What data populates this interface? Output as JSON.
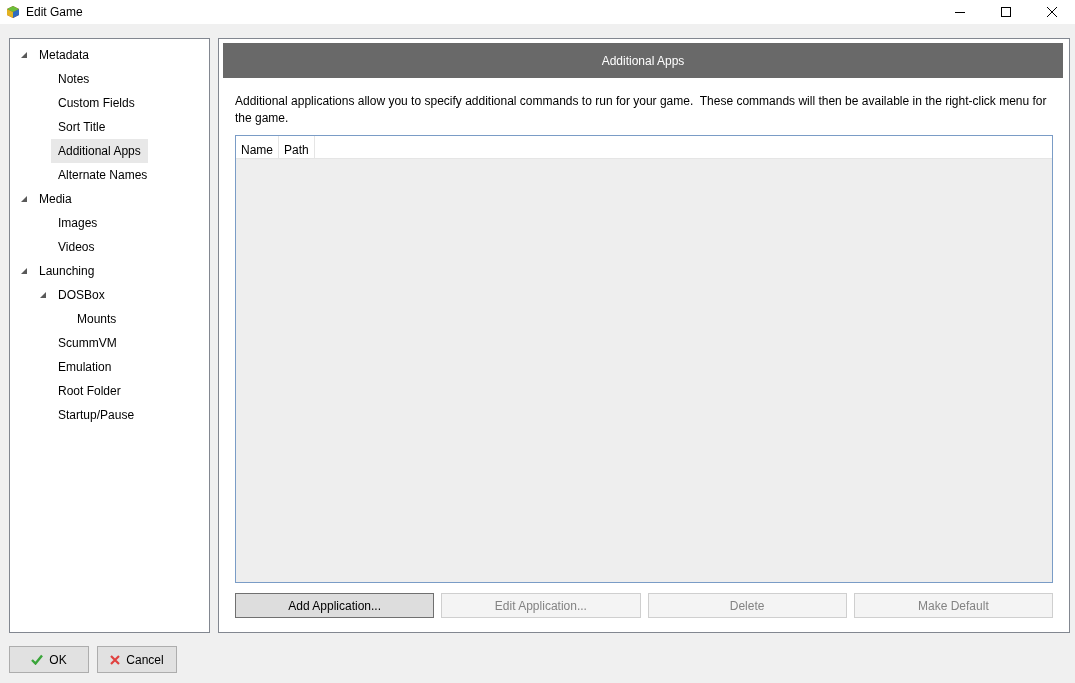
{
  "window": {
    "title": "Edit Game"
  },
  "tree": [
    {
      "label": "Metadata",
      "expanded": true,
      "selected": false,
      "children": [
        {
          "label": "Notes",
          "selected": false
        },
        {
          "label": "Custom Fields",
          "selected": false
        },
        {
          "label": "Sort Title",
          "selected": false
        },
        {
          "label": "Additional Apps",
          "selected": true
        },
        {
          "label": "Alternate Names",
          "selected": false
        }
      ]
    },
    {
      "label": "Media",
      "expanded": true,
      "selected": false,
      "children": [
        {
          "label": "Images",
          "selected": false
        },
        {
          "label": "Videos",
          "selected": false
        }
      ]
    },
    {
      "label": "Launching",
      "expanded": true,
      "selected": false,
      "children": [
        {
          "label": "DOSBox",
          "expanded": true,
          "selected": false,
          "children": [
            {
              "label": "Mounts",
              "selected": false
            }
          ]
        },
        {
          "label": "ScummVM",
          "selected": false
        },
        {
          "label": "Emulation",
          "selected": false
        },
        {
          "label": "Root Folder",
          "selected": false
        },
        {
          "label": "Startup/Pause",
          "selected": false
        }
      ]
    }
  ],
  "panel": {
    "title": "Additional Apps",
    "description": "Additional applications allow you to specify additional commands to run for your game.  These commands will then be available in the right-click menu for the game.",
    "table": {
      "columns": [
        "Name",
        "Path"
      ]
    },
    "buttons": [
      {
        "label": "Add Application...",
        "disabled": false
      },
      {
        "label": "Edit Application...",
        "disabled": true
      },
      {
        "label": "Delete",
        "disabled": true
      },
      {
        "label": "Make Default",
        "disabled": true
      }
    ]
  },
  "footer_buttons": [
    {
      "label": "OK",
      "kind": "ok"
    },
    {
      "label": "Cancel",
      "kind": "cancel"
    }
  ]
}
